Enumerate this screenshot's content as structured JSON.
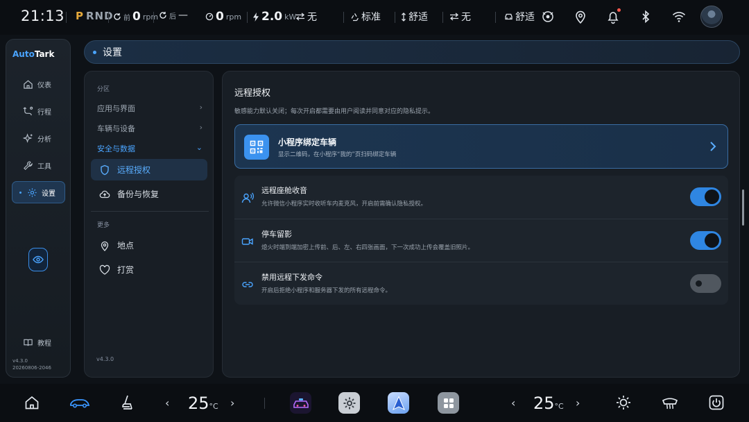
{
  "status_bar": {
    "time": "21:13",
    "gear_p": "P",
    "gear_rnd": "RND",
    "front_motor_label": "前",
    "front_motor_value": "0",
    "front_motor_unit": "rpm",
    "rear_motor_label": "后",
    "rear_motor_value": "—",
    "engine_value": "0",
    "engine_unit": "rpm",
    "power_value": "2.0",
    "power_unit": "kW",
    "regen_value": "无",
    "drive_mode": "标准",
    "suspension": "舒适",
    "steering": "无",
    "comfort_mode": "舒适"
  },
  "rail": {
    "brand_a": "Auto",
    "brand_b": "Tark",
    "items": [
      {
        "label": "仪表"
      },
      {
        "label": "行程"
      },
      {
        "label": "分析"
      },
      {
        "label": "工具"
      },
      {
        "label": "设置"
      }
    ],
    "tutorial": "教程",
    "version": "v4.3.0",
    "build": "20260806-2046"
  },
  "header": {
    "title": "设置"
  },
  "sections": {
    "partition_label": "分区",
    "categories": [
      {
        "label": "应用与界面",
        "chev": "›"
      },
      {
        "label": "车辆与设备",
        "chev": "›"
      },
      {
        "label": "安全与数据",
        "chev": "⌄"
      }
    ],
    "items": [
      {
        "label": "远程授权"
      },
      {
        "label": "备份与恢复"
      }
    ],
    "more_label": "更多",
    "more_items": [
      {
        "label": "地点"
      },
      {
        "label": "打赏"
      }
    ],
    "version": "v4.3.0"
  },
  "content": {
    "title": "远程授权",
    "description": "敏感能力默认关闭；每次开启都需要由用户阅读并同意对应的隐私提示。",
    "bind_card": {
      "title": "小程序绑定车辆",
      "subtitle": "显示二维码，在小程序“我的”页扫码绑定车辆"
    },
    "settings": [
      {
        "title": "远程座舱收音",
        "subtitle": "允许微信小程序实时收听车内麦克风，开启前需确认隐私授权。",
        "enabled": true
      },
      {
        "title": "停车留影",
        "subtitle": "熄火时端到端加密上传前、后、左、右四张画面，下一次成功上传会覆盖旧照片。",
        "enabled": true
      },
      {
        "title": "禁用远程下发命令",
        "subtitle": "开启后拒绝小程序和服务器下发的所有远程命令。",
        "enabled": false
      }
    ]
  },
  "dock": {
    "left_temp": "25",
    "right_temp": "25",
    "temp_unit": "°C",
    "dec": "‹",
    "inc": "›"
  },
  "colors": {
    "accent": "#3b92ef",
    "gear_p": "#e5a93b",
    "toggle_on": "#2f86e2",
    "toggle_off": "#50575f",
    "notify_dot": "#ff5a4e"
  }
}
